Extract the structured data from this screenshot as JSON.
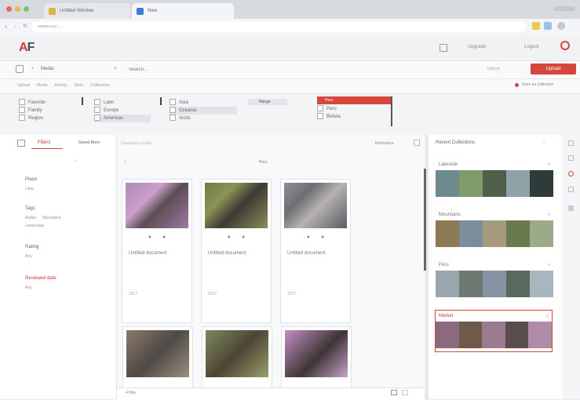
{
  "browser": {
    "tabs": [
      {
        "label": "Untitled Window"
      },
      {
        "label": "New"
      }
    ],
    "url": "amara.org / ..."
  },
  "app": {
    "logo_primary": "A",
    "logo_accent": "F",
    "header_links": [
      "Upgrade",
      "Logout"
    ],
    "search": {
      "scope": "Media",
      "placeholder": "Search..."
    },
    "action_button": "Upload",
    "options_link": "Options",
    "sub_links": [
      "Upload",
      "Media",
      "Activity",
      "Store",
      "Collections"
    ],
    "right_link": "Save as collection"
  },
  "filters": {
    "col1": [
      "Favorite",
      "Family",
      "Region"
    ],
    "col2": [
      "Latin",
      "Europe",
      "Americas"
    ],
    "col3": [
      "Asia",
      "Oceania",
      "Arctic"
    ],
    "col4": [
      "Range"
    ],
    "highlight": "Peru",
    "col5": [
      "Peru",
      "Bolivia"
    ]
  },
  "sidebar": {
    "tab_filters": "Filters",
    "tab_saved": "Saved filters",
    "groups": [
      {
        "title": "Place",
        "items": [
          "Lima"
        ]
      },
      {
        "title": "Tags",
        "items": [
          "Andes",
          "Mountains",
          "Landscape"
        ]
      },
      {
        "title": "Rating",
        "items": [
          "Any"
        ]
      },
      {
        "title": "Reviewed date",
        "items": [
          "Any"
        ]
      }
    ]
  },
  "results": {
    "toolbar_left": "Displaying results",
    "toolbar_right": "Relevance",
    "folder_label": "Peru",
    "cards": [
      {
        "label": "Untitled document",
        "date": "2017"
      },
      {
        "label": "Untitled document",
        "date": "2017"
      },
      {
        "label": "Untitled document",
        "date": "2017"
      }
    ],
    "footer": "4 files"
  },
  "collections": {
    "title": "Recent Collections",
    "items": [
      {
        "label": "Lakeside"
      },
      {
        "label": "Mountains"
      },
      {
        "label": "Peru"
      },
      {
        "label": "Market"
      }
    ]
  }
}
